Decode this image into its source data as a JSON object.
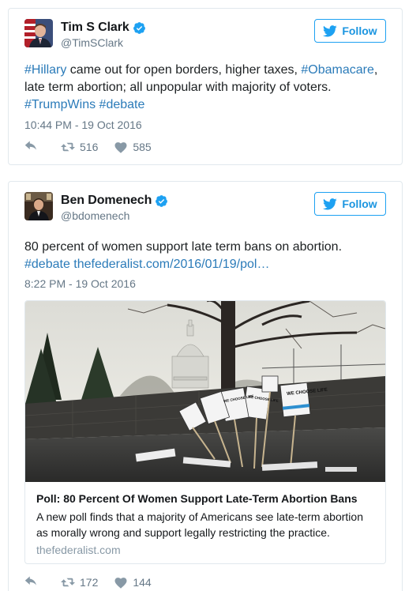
{
  "tweets": [
    {
      "display_name": "Tim S Clark",
      "handle": "@TimSClark",
      "follow_label": "Follow",
      "text_segments": [
        {
          "t": "#Hillary",
          "kind": "hashtag"
        },
        {
          "t": " came out for open borders, higher taxes, ",
          "kind": "text"
        },
        {
          "t": "#Obamacare",
          "kind": "hashtag"
        },
        {
          "t": ", late term abortion; all unpopular with majority of voters. ",
          "kind": "text"
        },
        {
          "t": "#TrumpWins",
          "kind": "hashtag"
        },
        {
          "t": " ",
          "kind": "text"
        },
        {
          "t": "#debate",
          "kind": "hashtag"
        }
      ],
      "timestamp": "10:44 PM - 19 Oct 2016",
      "retweets": "516",
      "likes": "585"
    },
    {
      "display_name": "Ben Domenech",
      "handle": "@bdomenech",
      "follow_label": "Follow",
      "text_segments": [
        {
          "t": "80 percent of women support late term bans on abortion. ",
          "kind": "text"
        },
        {
          "t": "#debate",
          "kind": "hashtag"
        },
        {
          "t": " ",
          "kind": "text"
        },
        {
          "t": "thefederalist.com/2016/01/19/pol…",
          "kind": "link"
        }
      ],
      "timestamp": "8:22 PM - 19 Oct 2016",
      "card": {
        "title": "Poll: 80 Percent Of Women Support Late-Term Abortion Bans",
        "description": "A new poll finds that a majority of Americans see late-term abortion as morally wrong and support legally restricting the practice.",
        "domain": "thefederalist.com",
        "sign_texts": [
          "WE CHOOSE LIFE",
          "WE CHOOSE LIFE",
          "WE CHOOSE LIFE"
        ]
      },
      "retweets": "172",
      "likes": "144"
    }
  ],
  "icons": {
    "follow": "twitter-bird-icon",
    "verified": "verified-badge-icon",
    "reply": "reply-icon",
    "retweet": "retweet-icon",
    "like": "heart-icon"
  },
  "colors": {
    "link": "#2b7bb9",
    "follow": "#1b95e0",
    "muted": "#657786",
    "verified": "#1da1f2",
    "border": "#e1e8ed"
  }
}
